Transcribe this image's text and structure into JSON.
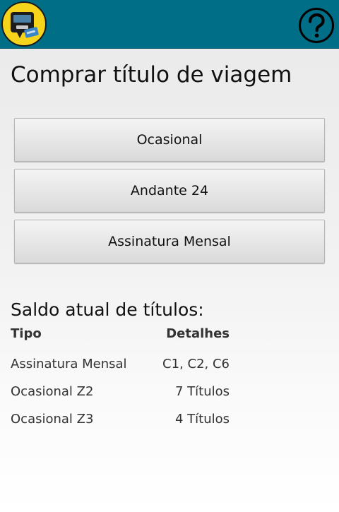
{
  "header": {
    "logo_icon": "ticket-machine-icon",
    "help_icon": "help-question-icon",
    "colors": {
      "bar": "#006e87",
      "logo_badge": "#f6d41c"
    }
  },
  "page": {
    "title": "Comprar título de viagem"
  },
  "purchase_options": [
    {
      "label": "Ocasional"
    },
    {
      "label": "Andante 24"
    },
    {
      "label": "Assinatura Mensal"
    }
  ],
  "balance": {
    "heading": "Saldo atual de títulos:",
    "columns": {
      "type": "Tipo",
      "details": "Detalhes"
    },
    "rows": [
      {
        "type": "Assinatura Mensal",
        "details": "C1, C2, C6"
      },
      {
        "type": "Ocasional Z2",
        "details": "7 Títulos"
      },
      {
        "type": "Ocasional Z3",
        "details": "4 Títulos"
      }
    ]
  }
}
